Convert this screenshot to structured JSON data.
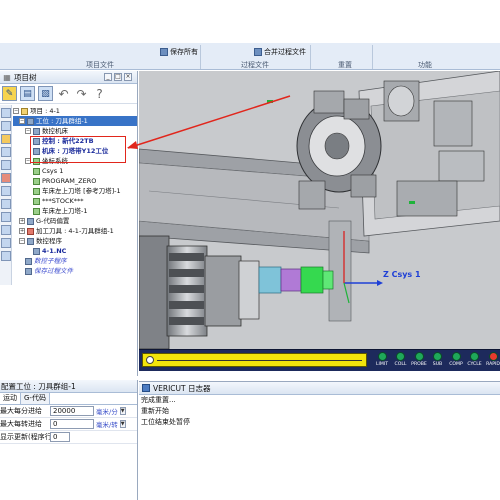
{
  "ribbon": {
    "save_all": "保存所有",
    "merge_process_files": "合并过程文件",
    "groups": [
      "项目文件",
      "过程文件",
      "重置",
      "功能"
    ]
  },
  "project_tree": {
    "title": "项目树",
    "nodes": [
      "项目 : 4-1",
      "工位 : 刀具群组-1",
      "数控机床",
      "控制 : 新代22TB",
      "机床 : 刀塔带Y12工位",
      "坐标系统",
      "Csys 1",
      "PROGRAM_ZERO",
      "车床左上刀塔 [参考刀塔]-1",
      "***STOCK***",
      "车床左上刀塔-1",
      "G-代码偏置",
      "加工刀具 : 4-1-刀具群组-1",
      "数控程序",
      "4-1.NC",
      "数控子程序",
      "保存过程文件"
    ]
  },
  "viewport": {
    "csys_label": "Z Csys 1"
  },
  "status_leds": [
    {
      "label": "LIMIT",
      "color": "#1fa85a"
    },
    {
      "label": "COLL",
      "color": "#1fa85a"
    },
    {
      "label": "PROBE",
      "color": "#1fa85a"
    },
    {
      "label": "SUB",
      "color": "#1fa85a"
    },
    {
      "label": "COMP",
      "color": "#1fa85a"
    },
    {
      "label": "CYCLE",
      "color": "#1fa85a"
    },
    {
      "label": "RAPID",
      "color": "#e73a2e"
    }
  ],
  "config_panel": {
    "title": "配置工位 : 刀具群组-1",
    "tabs": [
      "运动",
      "G-代码"
    ],
    "rows": [
      {
        "label": "最大每分进给",
        "value": "20000",
        "unit": "毫米/分"
      },
      {
        "label": "最大每转进给",
        "value": "0",
        "unit": "毫米/转"
      },
      {
        "label": "显示更新(程序行数)",
        "value": "0",
        "unit": ""
      }
    ]
  },
  "log": {
    "title": "VERICUT 日志器",
    "lines": [
      "完成重置...",
      "重新开始",
      "工位结束处暂停"
    ]
  }
}
